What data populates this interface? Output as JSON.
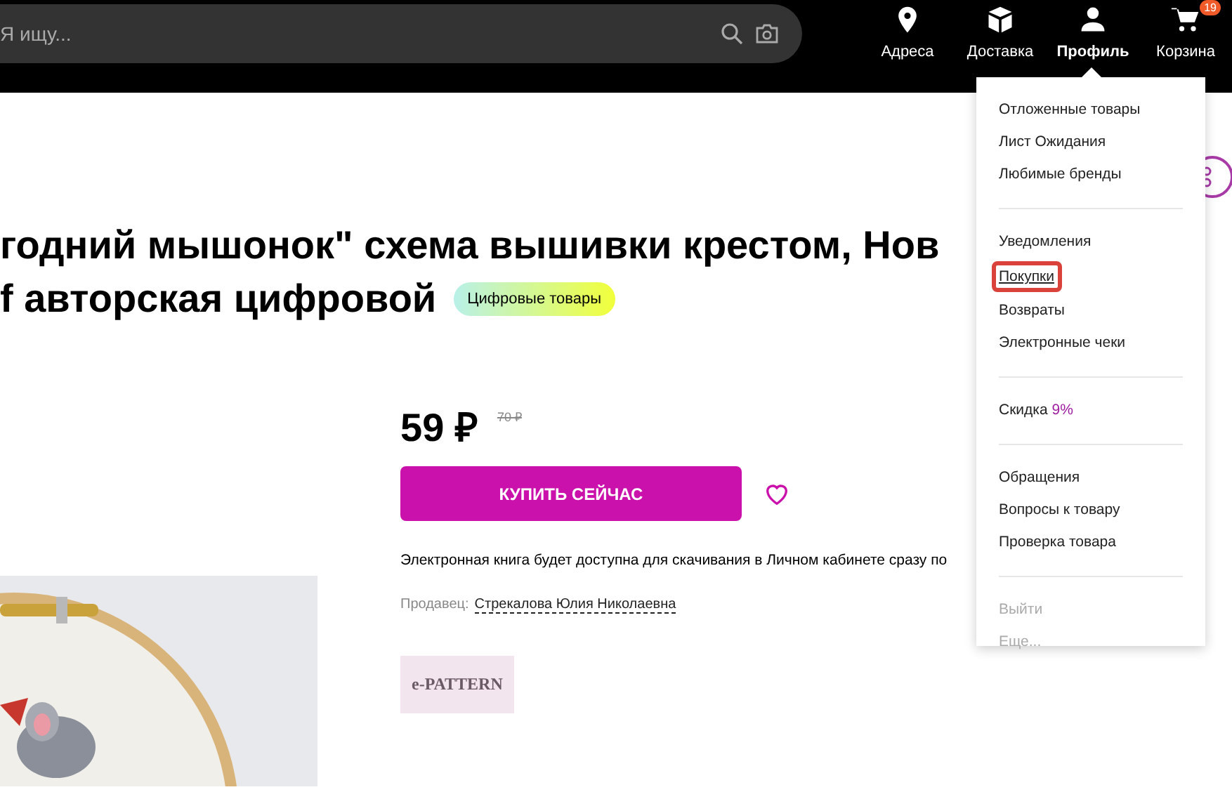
{
  "header": {
    "search": {
      "placeholder": "Я ищу..."
    },
    "nav": [
      {
        "kind": "pin",
        "label": "Адреса",
        "selected": false
      },
      {
        "kind": "box",
        "label": "Доставка",
        "selected": false
      },
      {
        "kind": "person",
        "label": "Профиль",
        "selected": true
      },
      {
        "kind": "cart",
        "label": "Корзина",
        "selected": false,
        "badge": "19"
      }
    ]
  },
  "product": {
    "title_lines": [
      "годний мышонок\" схема вышивки крестом, Нов",
      "f авторская цифровой"
    ],
    "category_badge": "Цифровые товары",
    "image": {
      "kind": "picture"
    },
    "price": "59 ₽",
    "old_price": "70 ₽",
    "buy_button": "КУПИТЬ СЕЙЧАС",
    "favorite": false,
    "note": "Электронная книга будет доступна для скачивания в Личном кабинете сразу по",
    "seller_label": "Продавец:",
    "seller_name": "Стрекалова Юлия Николаевна",
    "brand_logo": "e-PATTERN"
  },
  "profile_menu": {
    "groups": [
      [
        {
          "label": "Отложенные товары",
          "highlighted": false
        },
        {
          "label": "Лист Ожидания",
          "highlighted": false
        },
        {
          "label": "Любимые бренды",
          "highlighted": false
        }
      ],
      [
        {
          "label": "Уведомления",
          "highlighted": false
        },
        {
          "label": "Покупки",
          "highlighted": true
        },
        {
          "label": "Возвраты",
          "highlighted": false
        },
        {
          "label": "Электронные чеки",
          "highlighted": false
        }
      ],
      [
        {
          "label": "Скидка",
          "value": "9%",
          "highlighted": false
        }
      ],
      [
        {
          "label": "Обращения",
          "highlighted": false
        },
        {
          "label": "Вопросы к товару",
          "highlighted": false
        },
        {
          "label": "Проверка товара",
          "highlighted": false
        }
      ],
      [
        {
          "label": "Выйти",
          "highlighted": false,
          "disabled": true
        },
        {
          "label": "Еще...",
          "highlighted": false,
          "disabled": true
        }
      ]
    ]
  }
}
